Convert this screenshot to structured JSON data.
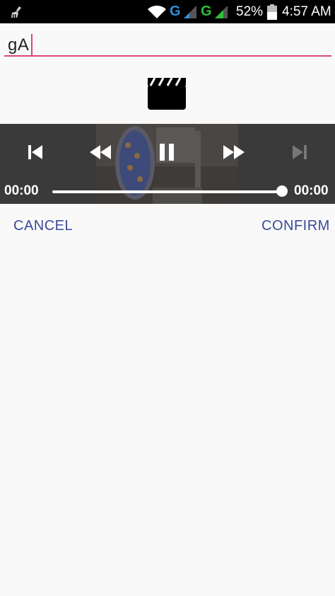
{
  "status_bar": {
    "left_icon": "cleaner-broom-icon",
    "wifi_icon": "wifi-icon",
    "network_1": "G",
    "network_2": "G",
    "battery_percent": "52%",
    "battery_icon": "battery-icon",
    "time": "4:57 AM",
    "colors": {
      "network_1": "#2f8fd8",
      "network_2": "#2fbe3a"
    }
  },
  "title_input": {
    "value": "gA",
    "accent_color": "#e0457b"
  },
  "media": {
    "icon": "movie-clapperboard-icon"
  },
  "player": {
    "controls": [
      "skip-previous-icon",
      "rewind-icon",
      "pause-icon",
      "fast-forward-icon",
      "skip-next-icon"
    ],
    "skip_next_enabled": false,
    "current_time": "00:00",
    "duration": "00:00",
    "progress": 1.0
  },
  "actions": {
    "cancel_label": "CANCEL",
    "confirm_label": "CONFIRM",
    "color": "#3a4a9a"
  }
}
